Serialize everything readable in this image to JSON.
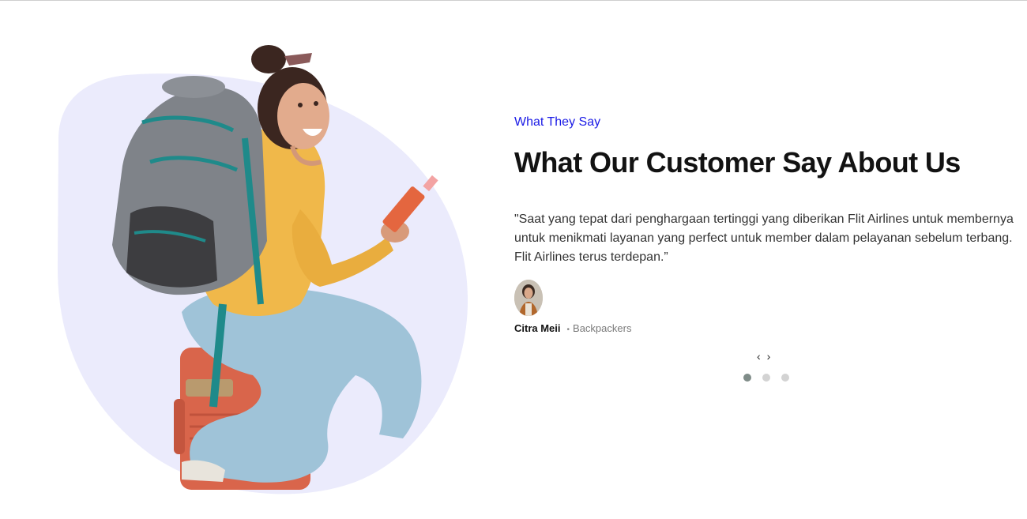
{
  "section": {
    "eyebrow": "What They Say",
    "headline": "What Our Customer Say About Us"
  },
  "testimonial": {
    "quote": "\"Saat yang tepat dari penghargaan tertinggi yang diberikan Flit Airlines untuk membernya untuk menikmati layanan yang perfect untuk member dalam pelayanan sebelum terbang. Flit Airlines terus terdepan.”",
    "author_name": "Citra Meii",
    "author_separator": "•",
    "author_role": "Backpackers"
  },
  "carousel": {
    "prev_label": "‹",
    "next_label": "›",
    "slide_count": 3,
    "active_slide": 1
  },
  "colors": {
    "accent": "#1a1ae6",
    "blob": "#ebebfc",
    "headline": "#121212",
    "dot_active": "#7f8c88",
    "dot_inactive": "#d3d3d3"
  },
  "icons": {
    "prev": "chevron-left-icon",
    "next": "chevron-right-icon"
  }
}
